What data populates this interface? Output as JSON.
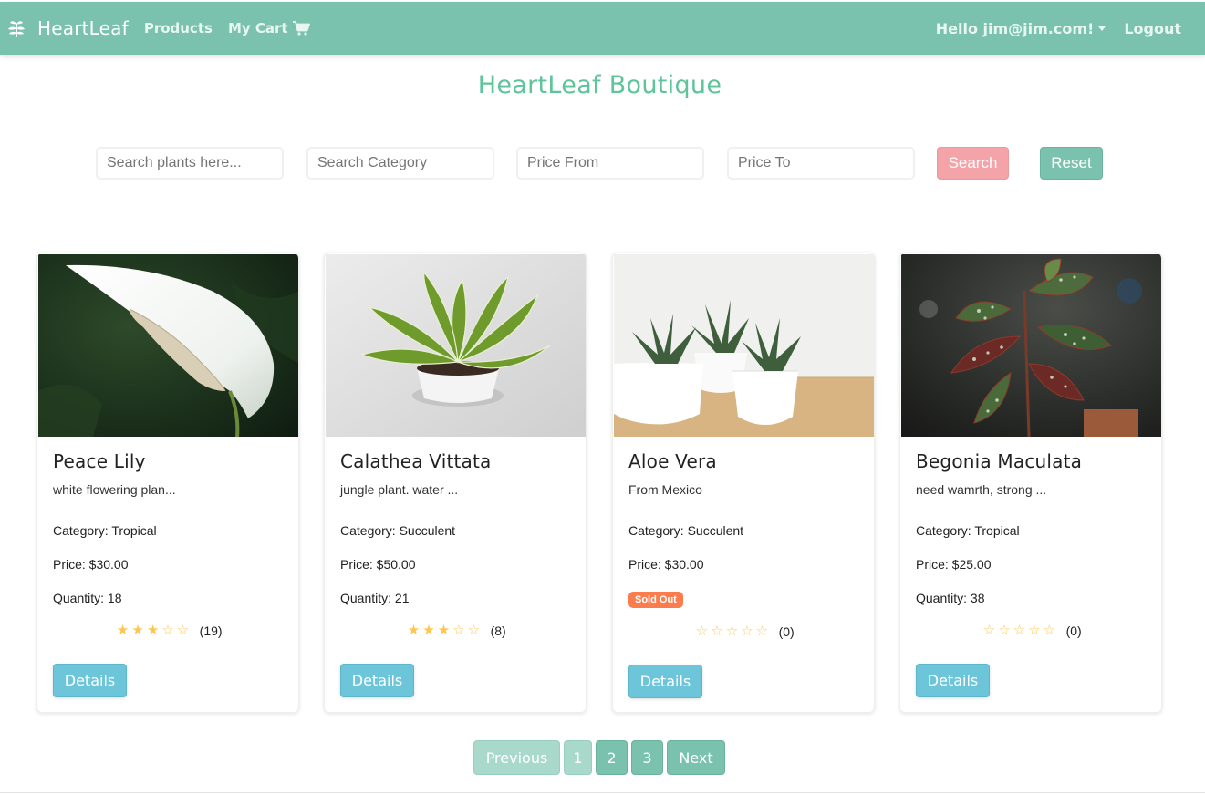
{
  "colors": {
    "navbar": "#7ac2ad",
    "title": "#5fc49a",
    "search_button": "#f4a3a8",
    "reset_button": "#7ac2ad",
    "details_button": "#6cc5d9",
    "sold_out_badge": "#fb7c4c",
    "star": "#ffc64f"
  },
  "navbar": {
    "brand": "HeartLeaf",
    "brand_icon": "leaf-icon",
    "products": "Products",
    "cart": "My Cart",
    "cart_icon": "shopping-cart-icon",
    "user_greeting": "Hello jim@jim.com!",
    "logout": "Logout"
  },
  "page": {
    "title": "HeartLeaf Boutique"
  },
  "search": {
    "plants_placeholder": "Search plants here...",
    "category_placeholder": "Search Category",
    "price_from_placeholder": "Price From",
    "price_to_placeholder": "Price To",
    "search_label": "Search",
    "reset_label": "Reset"
  },
  "products": [
    {
      "name": "Peace Lily",
      "description": "white flowering plan...",
      "category": "Category: Tropical",
      "price": "Price: $30.00",
      "quantity": "Quantity: 18",
      "sold_out": false,
      "rating": 3,
      "rating_max": 5,
      "rating_count": "(19)",
      "details_label": "Details",
      "image": "peace-lily-photo"
    },
    {
      "name": "Calathea Vittata",
      "description": "jungle plant. water ...",
      "category": "Category: Succulent",
      "price": "Price: $50.00",
      "quantity": "Quantity: 21",
      "sold_out": false,
      "rating": 3,
      "rating_max": 5,
      "rating_count": "(8)",
      "details_label": "Details",
      "image": "calathea-vittata-photo"
    },
    {
      "name": "Aloe Vera",
      "description": "From Mexico",
      "category": "Category: Succulent",
      "price": "Price: $30.00",
      "quantity": "",
      "sold_out": true,
      "sold_out_label": "Sold Out",
      "rating": 0,
      "rating_max": 5,
      "rating_count": "(0)",
      "details_label": "Details",
      "image": "aloe-vera-photo"
    },
    {
      "name": "Begonia Maculata",
      "description": "need wamrth, strong ...",
      "category": "Category: Tropical",
      "price": "Price: $25.00",
      "quantity": "Quantity: 38",
      "sold_out": false,
      "rating": 0,
      "rating_max": 5,
      "rating_count": "(0)",
      "details_label": "Details",
      "image": "begonia-maculata-photo"
    }
  ],
  "pagination": {
    "previous": "Previous",
    "pages": [
      "1",
      "2",
      "3"
    ],
    "current": "1",
    "next": "Next"
  }
}
